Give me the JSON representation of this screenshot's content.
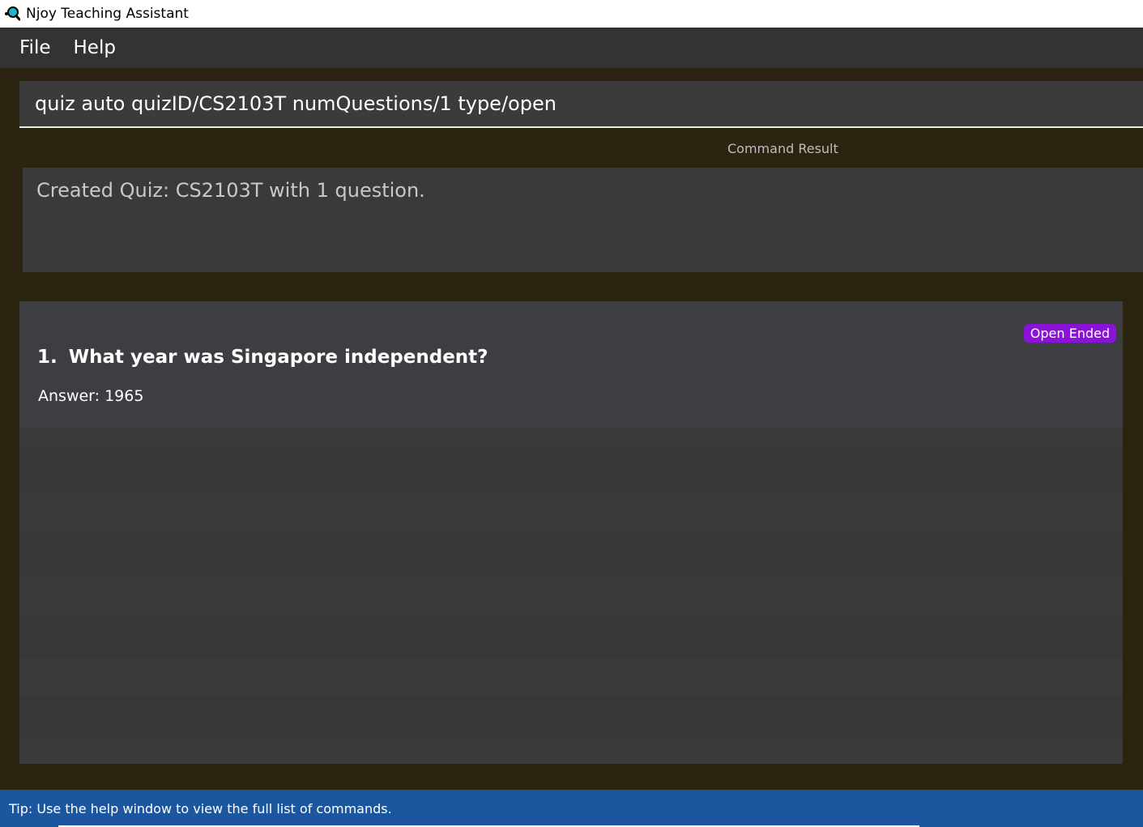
{
  "window": {
    "title": "Njoy Teaching Assistant",
    "icon": "magnifier-icon"
  },
  "menu": {
    "items": [
      "File",
      "Help"
    ]
  },
  "command": {
    "value": "quiz auto quizID/CS2103T numQuestions/1 type/open"
  },
  "result": {
    "label": "Command Result",
    "text": "Created Quiz: CS2103T with 1 question."
  },
  "questions": [
    {
      "number": "1.",
      "text": "What year was Singapore independent?",
      "answer": "Answer: 1965",
      "type_badge": "Open Ended",
      "badge_color": "#8a12d9"
    }
  ],
  "status": {
    "tip": "Tip: Use the help window to view the full list of commands."
  },
  "colors": {
    "background": "#2b2410",
    "menubar": "#333333",
    "statusbar": "#1c569f",
    "badge": "#8a12d9"
  }
}
